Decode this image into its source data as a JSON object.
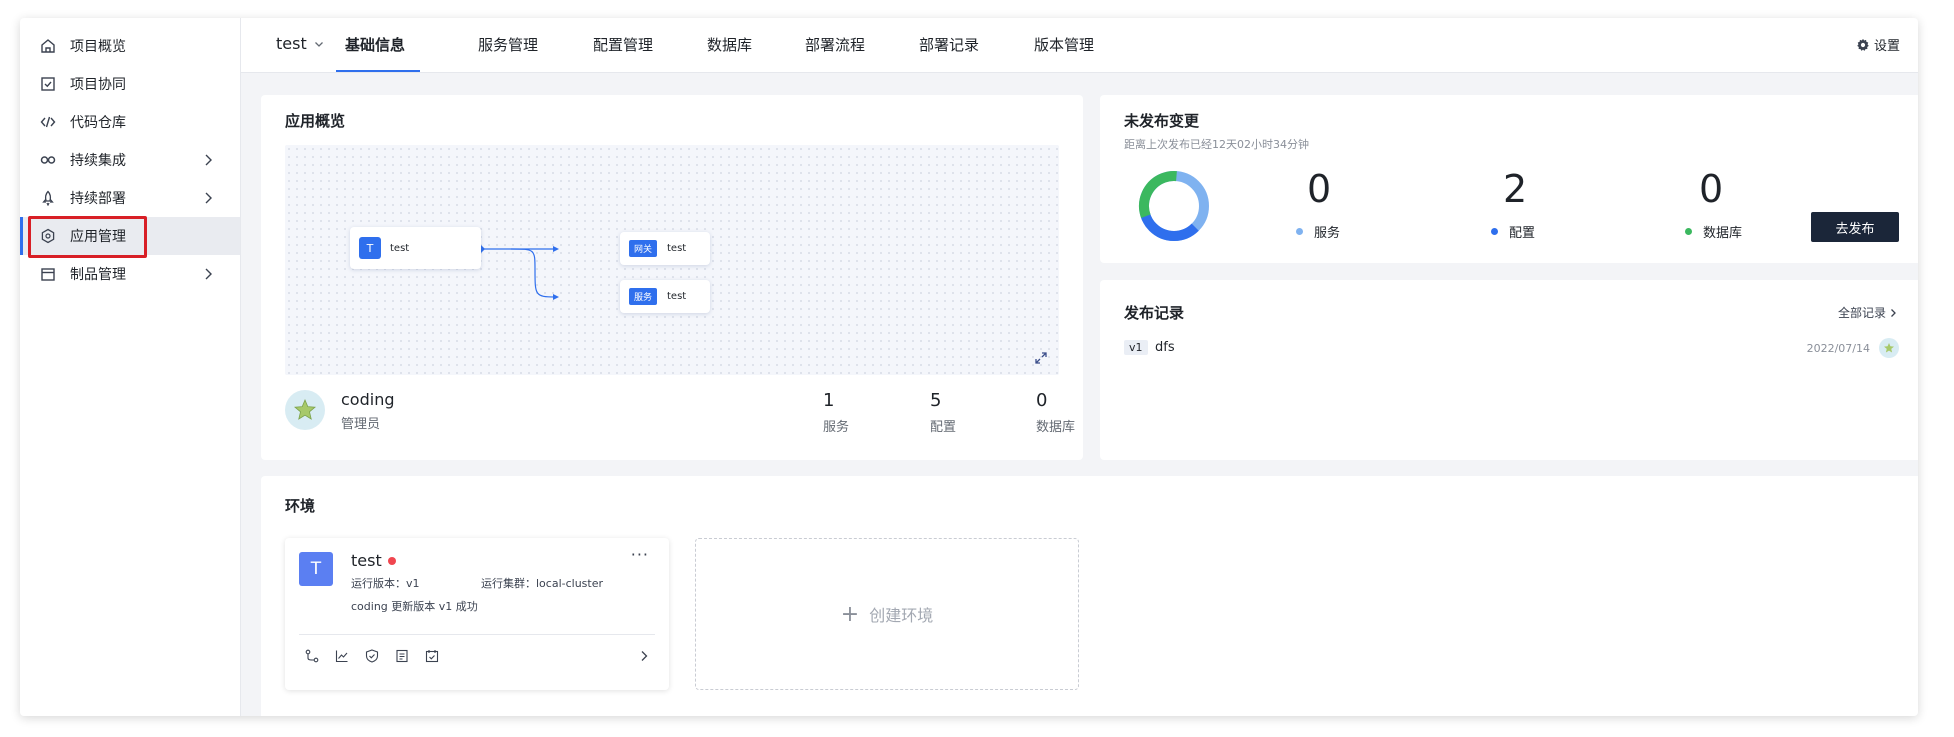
{
  "sidebar": {
    "items": [
      {
        "label": "项目概览",
        "icon": "home-icon"
      },
      {
        "label": "项目协同",
        "icon": "checkbox-icon"
      },
      {
        "label": "代码仓库",
        "icon": "code-icon"
      },
      {
        "label": "持续集成",
        "icon": "infinity-icon"
      },
      {
        "label": "持续部署",
        "icon": "rocket-icon"
      },
      {
        "label": "应用管理",
        "icon": "hexagon-icon"
      },
      {
        "label": "制品管理",
        "icon": "box-icon"
      }
    ]
  },
  "topnav": {
    "project": "test",
    "tabs": [
      "基础信息",
      "服务管理",
      "配置管理",
      "数据库",
      "部署流程",
      "部署记录",
      "版本管理"
    ],
    "settings": "设置"
  },
  "overview": {
    "title": "应用概览",
    "graph": {
      "root": {
        "avatar": "T",
        "name": "test"
      },
      "children": [
        {
          "tag": "网关",
          "name": "test"
        },
        {
          "tag": "服务",
          "name": "test"
        }
      ]
    },
    "owner": {
      "name": "coding",
      "role": "管理员"
    },
    "stats": [
      {
        "value": "1",
        "label": "服务"
      },
      {
        "value": "5",
        "label": "配置"
      },
      {
        "value": "0",
        "label": "数据库"
      }
    ]
  },
  "unpublished": {
    "title": "未发布变更",
    "subtitle": "距离上次发布已经12天02小时34分钟",
    "counts": [
      {
        "value": "0",
        "label": "服务",
        "color": "#7fb2f0"
      },
      {
        "value": "2",
        "label": "配置",
        "color": "#2f6fed"
      },
      {
        "value": "0",
        "label": "数据库",
        "color": "#3bb85f"
      }
    ],
    "button": "去发布"
  },
  "releases": {
    "title": "发布记录",
    "all_link": "全部记录",
    "items": [
      {
        "version": "v1",
        "name": "dfs",
        "date": "2022/07/14"
      }
    ]
  },
  "environment": {
    "title": "环境",
    "env": {
      "avatar": "T",
      "name": "test",
      "version_label": "运行版本：v1",
      "cluster_label": "运行集群：local-cluster",
      "activity": "coding 更新版本 v1 成功",
      "status_color": "#f0464f"
    },
    "create_label": "创建环境"
  },
  "colors": {
    "accent": "#2f6fed",
    "highlight": "#d81f26",
    "dark_button": "#1b2639"
  }
}
